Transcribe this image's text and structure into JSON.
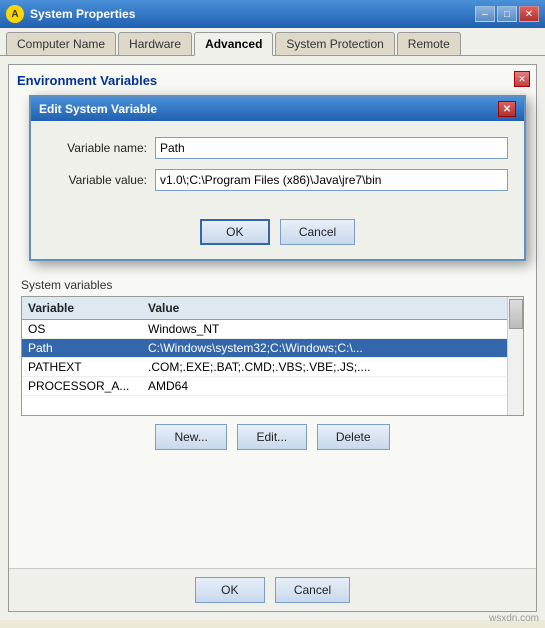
{
  "window": {
    "title": "System Properties",
    "controls": {
      "minimize": "–",
      "maximize": "□",
      "close": "✕"
    }
  },
  "tabs": [
    {
      "id": "computer-name",
      "label": "Computer Name"
    },
    {
      "id": "hardware",
      "label": "Hardware"
    },
    {
      "id": "advanced",
      "label": "Advanced"
    },
    {
      "id": "system-protection",
      "label": "System Protection"
    },
    {
      "id": "remote",
      "label": "Remote"
    }
  ],
  "active_tab": "advanced",
  "env_panel": {
    "title": "Environment Variables",
    "close_symbol": "✕"
  },
  "dialog": {
    "title": "Edit System Variable",
    "close_symbol": "✕",
    "fields": {
      "variable_name_label": "Variable name:",
      "variable_name_value": "Path",
      "variable_value_label": "Variable value:",
      "variable_value_value": "v1.0\\;C:\\Program Files (x86)\\Java\\jre7\\bin"
    },
    "buttons": {
      "ok": "OK",
      "cancel": "Cancel"
    }
  },
  "system_vars": {
    "section_label": "System variables",
    "columns": [
      "Variable",
      "Value"
    ],
    "rows": [
      {
        "variable": "OS",
        "value": "Windows_NT"
      },
      {
        "variable": "Path",
        "value": "C:\\Windows\\system32;C:\\Windows;C:\\..."
      },
      {
        "variable": "PATHEXT",
        "value": ".COM;.EXE;.BAT;.CMD;.VBS;.VBE;.JS;...."
      },
      {
        "variable": "PROCESSOR_A...",
        "value": "AMD64"
      }
    ]
  },
  "bottom_buttons": {
    "new": "New...",
    "edit": "Edit...",
    "delete": "Delete"
  },
  "main_buttons": {
    "ok": "OK",
    "cancel": "Cancel"
  },
  "watermark": "wsxdn.com"
}
